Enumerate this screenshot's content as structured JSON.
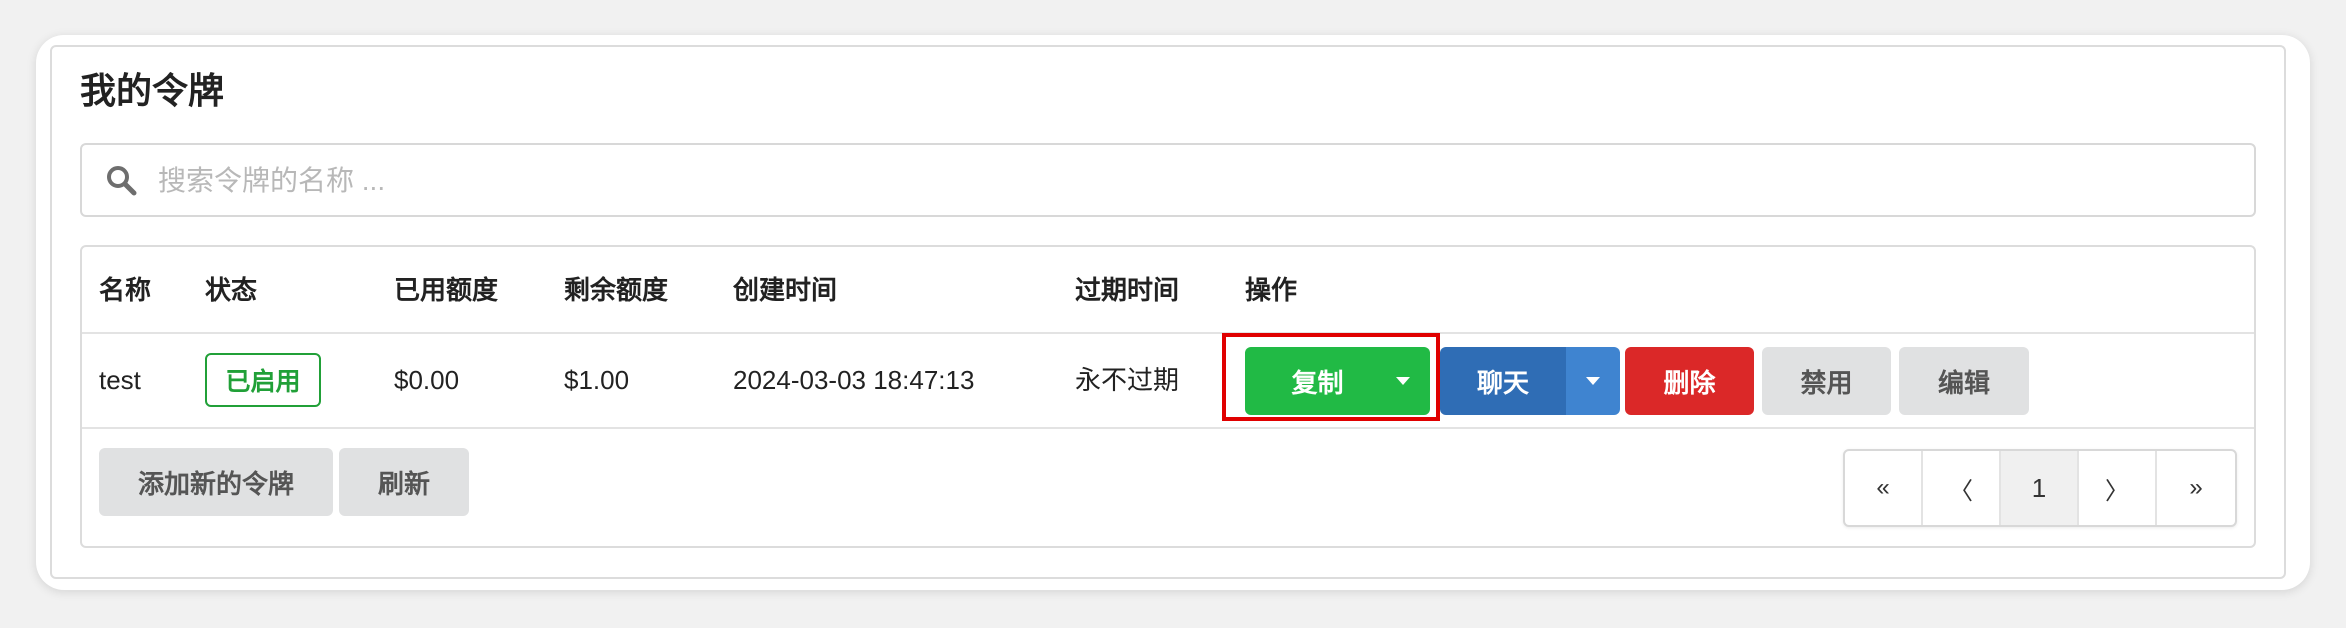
{
  "page": {
    "title": "我的令牌"
  },
  "search": {
    "placeholder": "搜索令牌的名称 ...",
    "value": ""
  },
  "table": {
    "headers": [
      "名称",
      "状态",
      "已用额度",
      "剩余额度",
      "创建时间",
      "过期时间",
      "操作"
    ],
    "rows": [
      {
        "name": "test",
        "status": "已启用",
        "used": "$0.00",
        "remaining": "$1.00",
        "created": "2024-03-03 18:47:13",
        "expires": "永不过期"
      }
    ],
    "actions": {
      "copy": "复制",
      "chat": "聊天",
      "delete": "删除",
      "disable": "禁用",
      "edit": "编辑"
    }
  },
  "footer": {
    "add_label": "添加新的令牌",
    "refresh_label": "刷新"
  },
  "pagination": {
    "first": "«",
    "prev": "〈",
    "current": "1",
    "next": "〉",
    "last": "»"
  },
  "colors": {
    "green": "#21ba45",
    "blue": "#2f6db5",
    "red": "#db2828",
    "grey": "#e0e1e2",
    "status_green": "#21a038",
    "highlight": "#e00000"
  },
  "icons": {
    "search": "search-icon",
    "dropdown": "caret-down-icon"
  }
}
